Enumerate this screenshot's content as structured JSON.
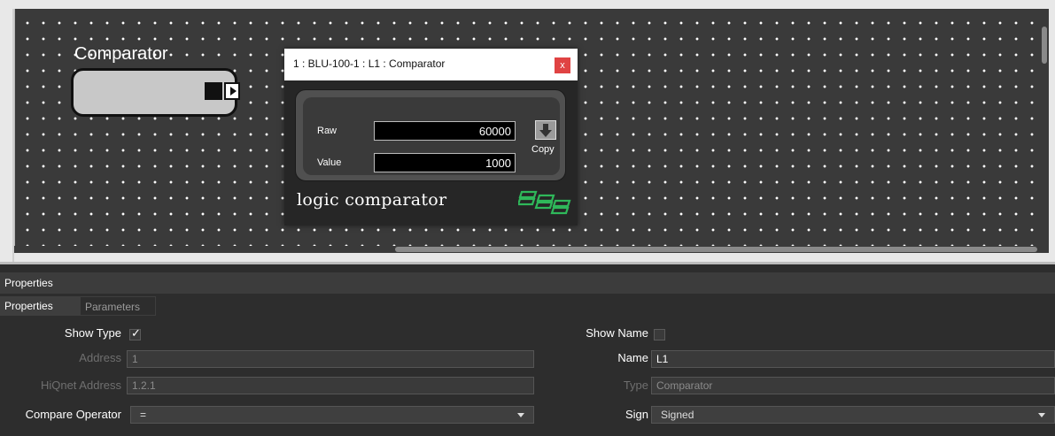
{
  "canvas": {
    "block_title": "Comparator"
  },
  "window": {
    "title": "1 : BLU-100-1 : L1 : Comparator",
    "close_glyph": "x",
    "raw_label": "Raw",
    "raw_value": "60000",
    "value_label": "Value",
    "value_value": "1000",
    "copy_label": "Copy",
    "footer_text": "logic comparator",
    "logo_icon": "bss-logo-icon"
  },
  "properties": {
    "header": "Properties",
    "tabs": [
      {
        "label": "Properties",
        "active": true
      },
      {
        "label": "Parameters",
        "active": false
      }
    ],
    "left": {
      "show_type_label": "Show Type",
      "show_type_checked": true,
      "address_label": "Address",
      "address_value": "1",
      "hiqnet_label": "HiQnet Address",
      "hiqnet_value": "1.2.1",
      "compare_label": "Compare Operator",
      "compare_value": "="
    },
    "right": {
      "show_name_label": "Show Name",
      "show_name_checked": false,
      "name_label": "Name",
      "name_value": "L1",
      "type_label": "Type",
      "type_value": "Comparator",
      "sign_label": "Sign",
      "sign_value": "Signed"
    }
  },
  "colors": {
    "accent_close": "#e04343",
    "logo_green": "#2fb85a"
  }
}
